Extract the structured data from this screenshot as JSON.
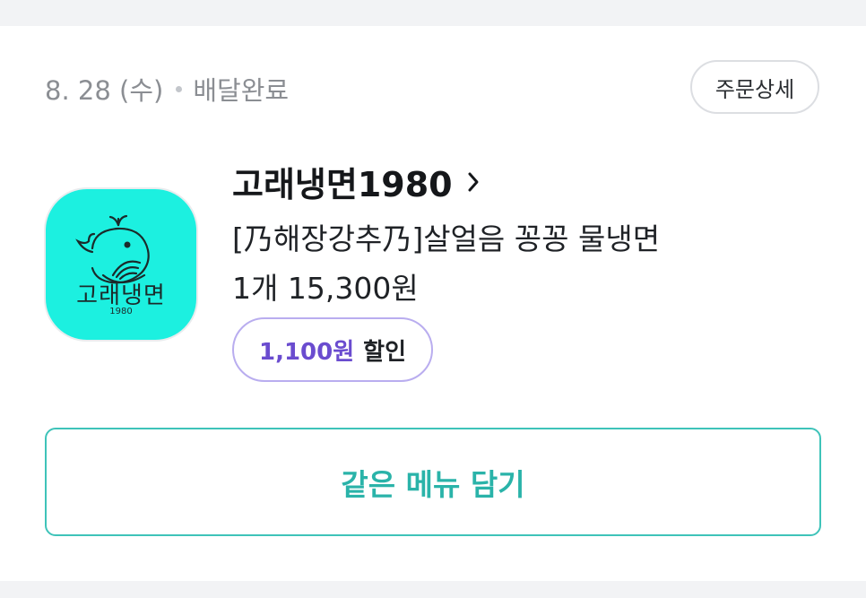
{
  "order": {
    "date": "8. 28 (수)",
    "status": "배달완료",
    "detail_button": "주문상세"
  },
  "store": {
    "name": "고래냉면1980",
    "logo": {
      "text": "고래냉면",
      "sub": "1980",
      "background": "#1cf0e0",
      "icon": "whale-icon"
    }
  },
  "item": {
    "menu": "[乃해장강추乃]살얼음 꽁꽁 물냉면",
    "quantity_price": "1개 15,300원"
  },
  "discount": {
    "amount": "1,100원",
    "label": "할인"
  },
  "actions": {
    "reorder_label": "같은 메뉴 담기"
  },
  "colors": {
    "accent": "#2ab3a9",
    "discount": "#6a4ccf",
    "discount_border": "#b9adef"
  }
}
